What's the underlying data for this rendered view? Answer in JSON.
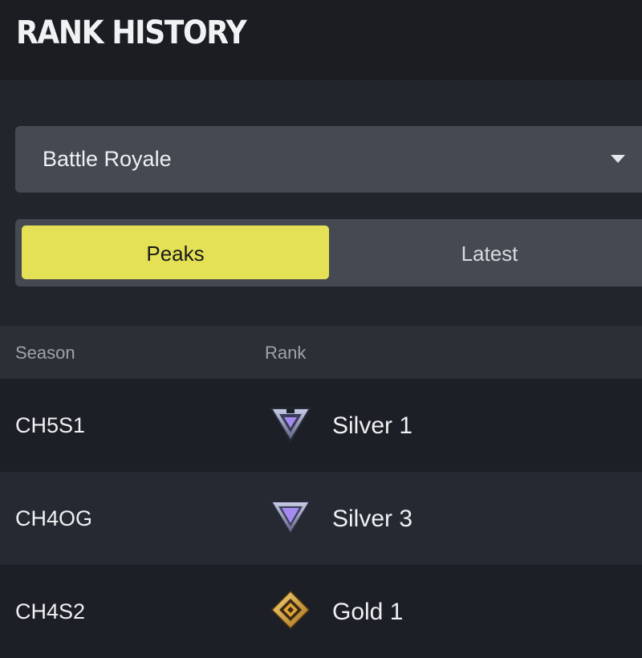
{
  "header": {
    "title": "RANK HISTORY"
  },
  "mode_select": {
    "value": "Battle Royale"
  },
  "view_toggle": {
    "options": [
      "Peaks",
      "Latest"
    ],
    "selected": "Peaks"
  },
  "table": {
    "columns": [
      "Season",
      "Rank"
    ],
    "rows": [
      {
        "season": "CH5S1",
        "rank": "Silver 1",
        "icon": "silver-rank-icon"
      },
      {
        "season": "CH4OG",
        "rank": "Silver 3",
        "icon": "silver-rank-icon"
      },
      {
        "season": "CH4S2",
        "rank": "Gold 1",
        "icon": "gold-rank-icon"
      }
    ]
  },
  "colors": {
    "accent": "#e4e157",
    "background": "#1e2127",
    "silver": "#a58af0",
    "gold": "#e0a534"
  }
}
